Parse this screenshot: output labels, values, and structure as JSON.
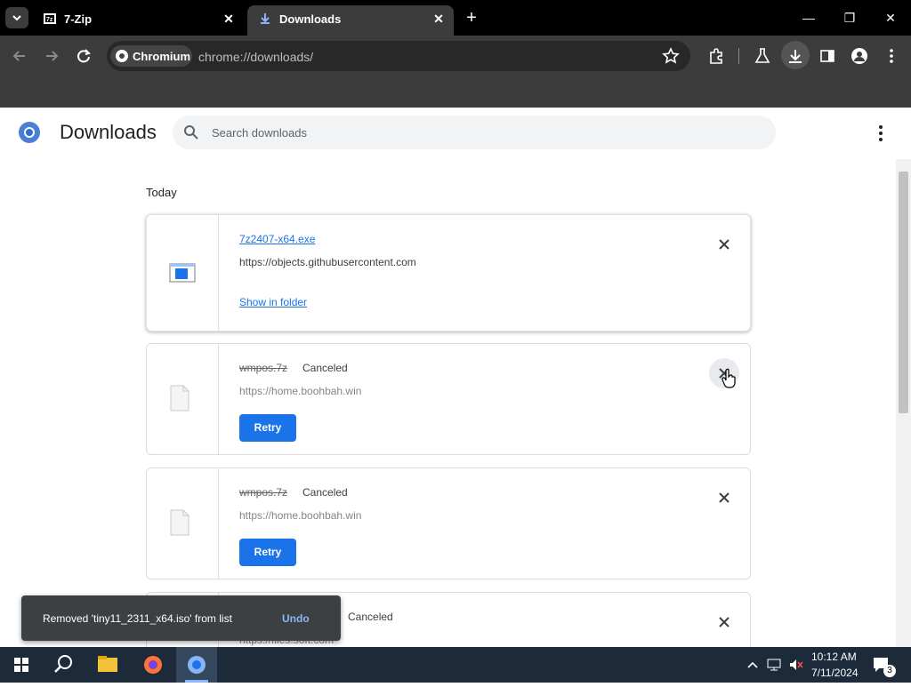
{
  "tabs": [
    {
      "title": "7-Zip",
      "icon": "7zip-icon"
    },
    {
      "title": "Downloads",
      "icon": "download-icon",
      "active": true
    }
  ],
  "omnibox": {
    "chip": "Chromium",
    "url": "chrome://downloads/"
  },
  "page": {
    "title": "Downloads",
    "search_placeholder": "Search downloads",
    "section": "Today"
  },
  "downloads": [
    {
      "name": "7z2407-x64.exe",
      "source": "https://objects.githubusercontent.com",
      "action": "Show in folder",
      "status": ""
    },
    {
      "name": "wmpos.7z",
      "source": "https://home.boohbah.win",
      "action": "Retry",
      "status": "Canceled"
    },
    {
      "name": "wmpos.7z",
      "source": "https://home.boohbah.win",
      "action": "Retry",
      "status": "Canceled"
    },
    {
      "name": "",
      "source": "https://files.soft.com",
      "action": "",
      "status": "Canceled"
    }
  ],
  "toast": {
    "message": "Removed 'tiny11_2311_x64.iso' from list",
    "undo": "Undo"
  },
  "taskbar": {
    "time": "10:12 AM",
    "date": "7/11/2024",
    "notification_count": "3"
  },
  "colors": {
    "accent": "#1a73e8",
    "chrome_bg": "#3c3c3c",
    "taskbar": "#1c2a3a"
  }
}
